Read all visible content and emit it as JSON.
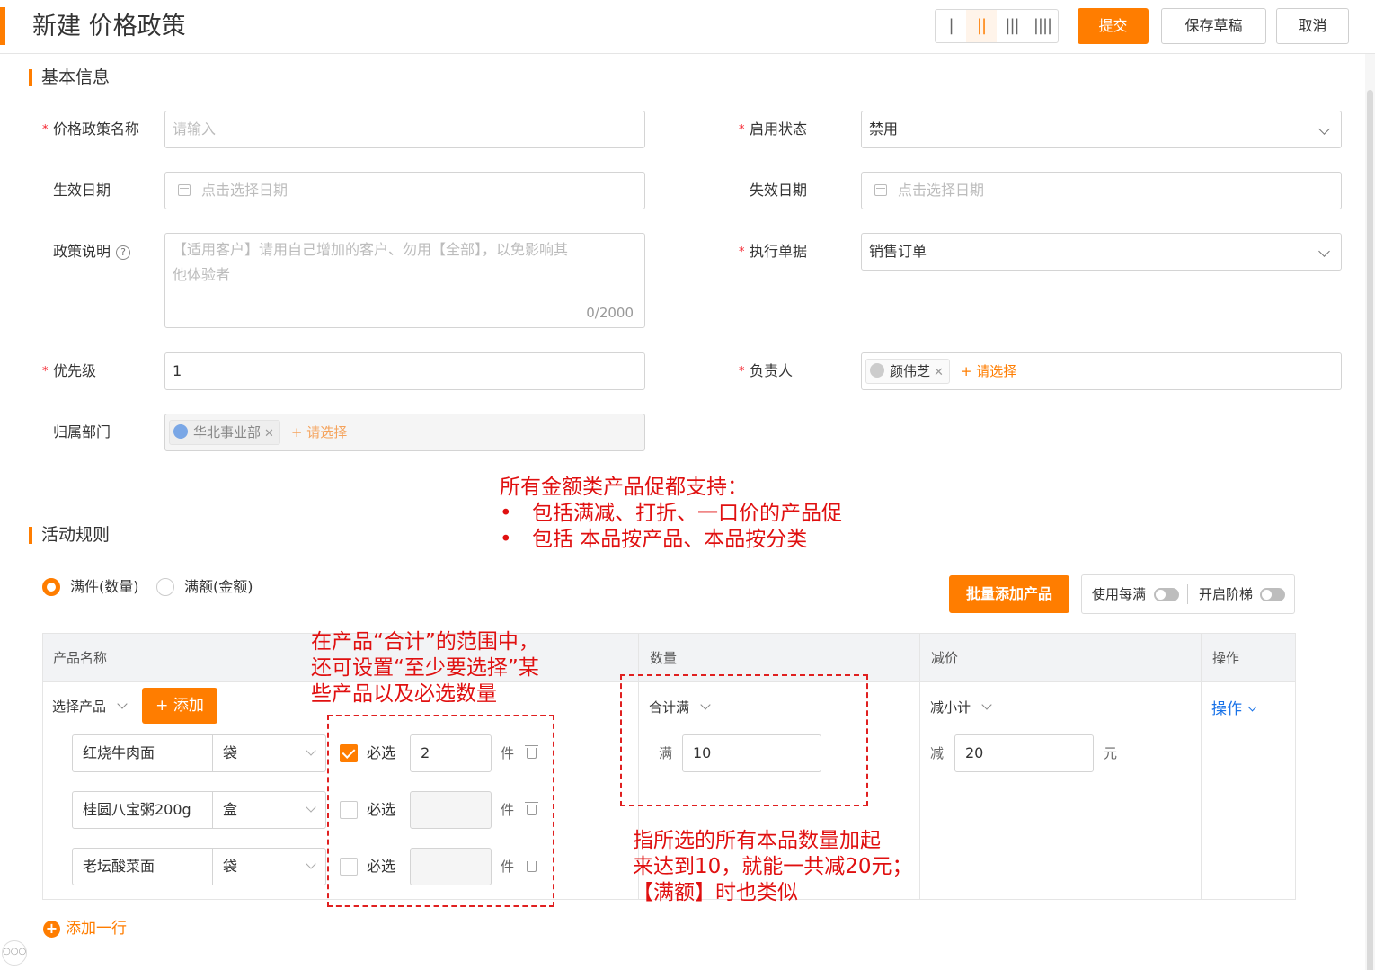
{
  "header": {
    "title": "新建 价格政策",
    "columns": [
      "|",
      "||",
      "|||",
      "||||"
    ],
    "submit": "提交",
    "save_draft": "保存草稿",
    "cancel": "取消"
  },
  "basic": {
    "section_title": "基本信息",
    "policy_name": {
      "label": "价格政策名称",
      "placeholder": "请输入"
    },
    "status": {
      "label": "启用状态",
      "value": "禁用"
    },
    "start_date": {
      "label": "生效日期",
      "placeholder": "点击选择日期"
    },
    "end_date": {
      "label": "失效日期",
      "placeholder": "点击选择日期"
    },
    "description": {
      "label": "政策说明",
      "placeholder_line1": "【适用客户】请用自己增加的客户、勿用【全部】，以免影响其",
      "placeholder_line2": "他体验者",
      "counter": "0/2000"
    },
    "doc": {
      "label": "执行单据",
      "value": "销售订单"
    },
    "priority": {
      "label": "优先级",
      "value": "1"
    },
    "owner": {
      "label": "负责人",
      "tag": "颜伟芝",
      "add": "+ 请选择"
    },
    "dept": {
      "label": "归属部门",
      "tag": "华北事业部",
      "add": "+ 请选择"
    }
  },
  "notes": {
    "top_line1": "所有金额类产品促都支持：",
    "top_bullet1": "包括满减、打折、一口价的产品促",
    "top_bullet2": "包括 本品按产品、本品按分类",
    "mid_line1": "在产品“合计”的范围中，",
    "mid_line2": "还可设置“至少要选择”某",
    "mid_line3": "些产品以及必选数量",
    "bottom_line1": "指所选的所有本品数量加起",
    "bottom_line2": "来达到10，就能一共减20元；",
    "bottom_line3": "【满额】时也类似",
    "bullet_char": "•"
  },
  "rules": {
    "section_title": "活动规则",
    "radio_qty": "满件(数量)",
    "radio_amt": "满额(金额)",
    "batch_add": "批量添加产品",
    "use_each": "使用每满",
    "enable_ladder": "开启阶梯"
  },
  "table": {
    "headers": {
      "name": "产品名称",
      "qty": "数量",
      "discount": "减价",
      "op": "操作"
    },
    "select_product": "选择产品",
    "add": "+ 添加",
    "rows": [
      {
        "name": "红烧牛肉面",
        "unit": "袋",
        "required_label": "必选",
        "required": true,
        "count": "2",
        "unit_suffix": "件"
      },
      {
        "name": "桂圆八宝粥200g",
        "unit": "盒",
        "required_label": "必选",
        "required": false,
        "count": "",
        "unit_suffix": "件"
      },
      {
        "name": "老坛酸菜面",
        "unit": "袋",
        "required_label": "必选",
        "required": false,
        "count": "",
        "unit_suffix": "件"
      }
    ],
    "qty_mode": "合计满",
    "qty_prefix": "满",
    "qty_value": "10",
    "disc_mode": "减小计",
    "disc_prefix": "减",
    "disc_value": "20",
    "disc_suffix": "元",
    "op_label": "操作"
  },
  "footer": {
    "add_row": "添加一行",
    "more": "○○○"
  },
  "colors": {
    "accent": "#ff7d00",
    "annotation": "#e01010"
  }
}
